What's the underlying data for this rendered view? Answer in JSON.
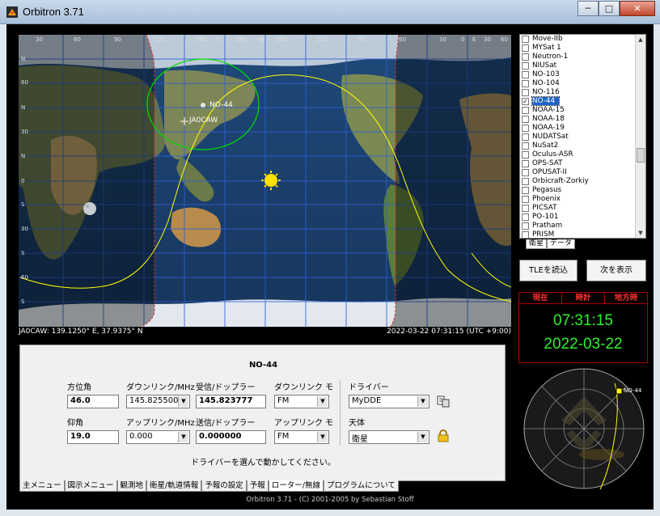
{
  "window": {
    "title": "Orbitron 3.71",
    "minimize": "─",
    "maximize": "□",
    "close": "✕"
  },
  "map": {
    "top_labels": [
      "30",
      "60",
      "90",
      "120",
      "150",
      "E",
      "180",
      "W",
      "150",
      "120",
      "90",
      "60",
      "30",
      "0",
      "E",
      "30",
      "60"
    ],
    "side_labels": [
      "N",
      "60",
      "N",
      "30",
      "N",
      "0",
      "S",
      "30",
      "S",
      "60",
      "S"
    ],
    "markers": {
      "satellite": "NO-44",
      "observer": "JA0CAW"
    },
    "status_left": "JA0CAW: 139.1250°  E, 37.9375°  N",
    "status_right": "2022-03-22 07:31:15 (UTC +9:00)"
  },
  "panel": {
    "title": "NO-44",
    "azimuth_label": "方位角",
    "azimuth_value": "46.0",
    "elevation_label": "仰角",
    "elevation_value": "19.0",
    "downlink_label": "ダウンリンク/MHz",
    "downlink_value": "145.825500",
    "uplink_label": "アップリンク/MHz",
    "uplink_value": "0.000",
    "rx_doppler_label": "受信/ドップラー",
    "rx_doppler_value": "145.823777",
    "tx_doppler_label": "送信/ドップラー",
    "tx_doppler_value": "0.000000",
    "downlink_mode_label": "ダウンリンク モ",
    "downlink_mode_value": "FM",
    "uplink_mode_label": "アップリンク モ",
    "uplink_mode_value": "FM",
    "driver_label": "ドライバー",
    "driver_value": "MyDDE",
    "body_label": "天体",
    "body_value": "衛星",
    "hint": "ドライバーを選んで動かしてください。"
  },
  "tabs": [
    "主メニュー",
    "図示メニュー",
    "観測地",
    "衛星/軌道情報",
    "予報の設定",
    "予報",
    "ローター/無線",
    "プログラムについて"
  ],
  "footer": "Orbitron 3.71 - (C) 2001-2005 by Sebastian Stoff",
  "satellites": [
    {
      "name": "Move-IIb",
      "checked": false
    },
    {
      "name": "MYSat 1",
      "checked": false
    },
    {
      "name": "Neutron-1",
      "checked": false
    },
    {
      "name": "NIUSat",
      "checked": false
    },
    {
      "name": "NO-103",
      "checked": false
    },
    {
      "name": "NO-104",
      "checked": false
    },
    {
      "name": "NO-116",
      "checked": false
    },
    {
      "name": "NO-44",
      "checked": true,
      "selected": true
    },
    {
      "name": "NOAA-15",
      "checked": false
    },
    {
      "name": "NOAA-18",
      "checked": false
    },
    {
      "name": "NOAA-19",
      "checked": false
    },
    {
      "name": "NUDATSat",
      "checked": false
    },
    {
      "name": "NuSat2",
      "checked": false
    },
    {
      "name": "Oculus-ASR",
      "checked": false
    },
    {
      "name": "OPS-SAT",
      "checked": false
    },
    {
      "name": "OPUSAT-II",
      "checked": false
    },
    {
      "name": "Orbicraft-Zorkiy",
      "checked": false
    },
    {
      "name": "Pegasus",
      "checked": false
    },
    {
      "name": "Phoenix",
      "checked": false
    },
    {
      "name": "PICSAT",
      "checked": false
    },
    {
      "name": "PO-101",
      "checked": false
    },
    {
      "name": "Pratham",
      "checked": false
    },
    {
      "name": "PRISM",
      "checked": false
    }
  ],
  "right_tabs": [
    "衛星",
    "データ"
  ],
  "buttons": {
    "load_tle": "TLEを読込",
    "next": "次を表示"
  },
  "clock": {
    "head_now": "現在",
    "head_clock": "時計",
    "head_local": "地方時",
    "time": "07:31:15",
    "date": "2022-03-22"
  },
  "radar": {
    "sat_label": "NO-44"
  },
  "colors": {
    "clock_green": "#2ef22e",
    "clock_red": "#ff3030",
    "selection": "#1e64c8",
    "orbit_yellow": "#ffff00",
    "footprint_green": "#00e000"
  }
}
